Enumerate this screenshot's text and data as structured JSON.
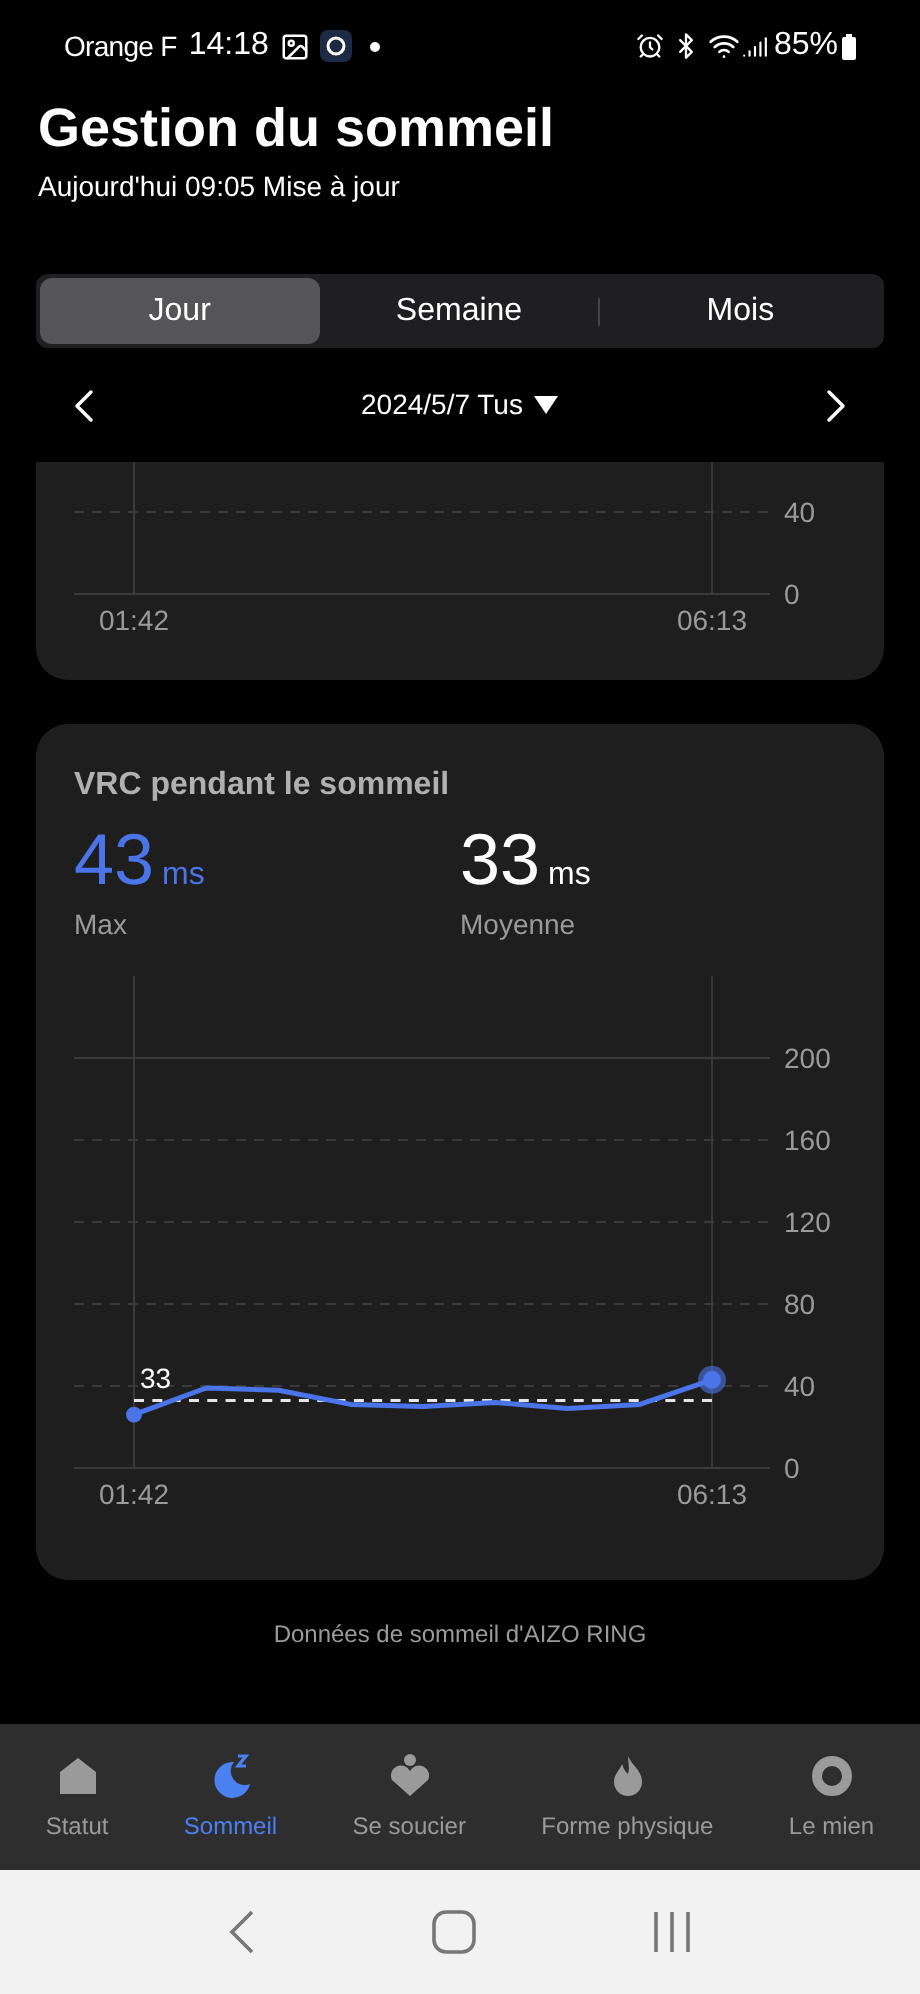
{
  "status_bar": {
    "carrier": "Orange F",
    "time": "14:18",
    "battery": "85%"
  },
  "header": {
    "title": "Gestion du sommeil",
    "subtitle": "Aujourd'hui 09:05 Mise à jour"
  },
  "tabs": [
    {
      "label": "Jour",
      "selected": true
    },
    {
      "label": "Semaine",
      "selected": false
    },
    {
      "label": "Mois",
      "selected": false
    }
  ],
  "date_nav": {
    "date": "2024/5/7 Tus"
  },
  "previous_card": {
    "y_tick_labels": [
      "40",
      "0"
    ],
    "x_tick_labels": [
      "01:42",
      "06:13"
    ]
  },
  "hrv_card": {
    "title": "VRC pendant le sommeil",
    "stats": [
      {
        "value": "43",
        "unit": "ms",
        "label": "Max",
        "kind": "max"
      },
      {
        "value": "33",
        "unit": "ms",
        "label": "Moyenne",
        "kind": "average"
      }
    ],
    "chart_data": {
      "type": "line",
      "categories": [
        "01:42",
        null,
        null,
        null,
        null,
        null,
        null,
        null,
        "06:13"
      ],
      "ylim": [
        0,
        200
      ],
      "yticks": [
        0,
        40,
        80,
        120,
        160,
        200
      ],
      "series": [
        {
          "color": "#4a74e8",
          "line_style": "solid",
          "values": [
            26,
            39,
            38,
            31,
            30,
            32,
            29,
            31,
            43
          ]
        },
        {
          "color": "#e5e5e5",
          "line_style": "dashed",
          "values": [
            33,
            33,
            33,
            33,
            33,
            33,
            33,
            33,
            33
          ]
        }
      ],
      "grid": true
    },
    "average_marker": "33"
  },
  "footer": {
    "text": "Données de sommeil d'AIZO RING"
  },
  "bottom_nav": [
    {
      "label": "Statut",
      "kind": "home",
      "selected": false
    },
    {
      "label": "Sommeil",
      "kind": "sleep",
      "selected": true
    },
    {
      "label": "Se soucier",
      "kind": "care",
      "selected": false
    },
    {
      "label": "Forme physique",
      "kind": "fitness",
      "selected": false
    },
    {
      "label": "Le mien",
      "kind": "me",
      "selected": false
    }
  ]
}
